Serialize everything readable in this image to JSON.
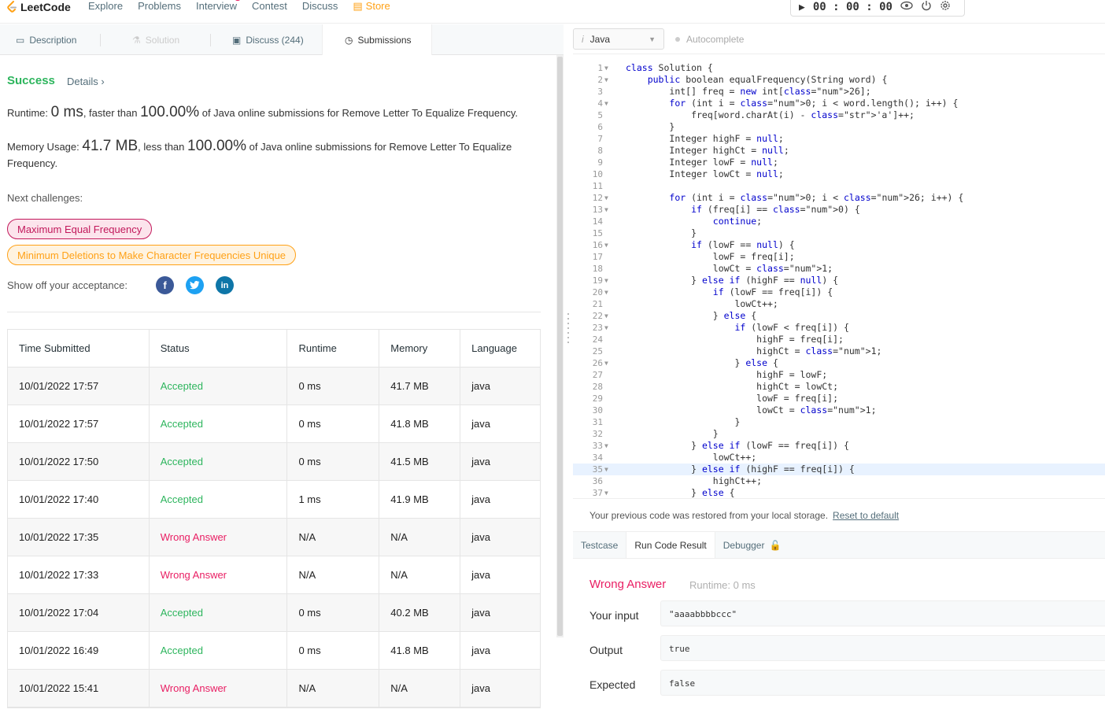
{
  "nav": {
    "logo": "LeetCode",
    "items": [
      "Explore",
      "Problems",
      "Interview",
      "Contest",
      "Discuss"
    ],
    "new_badge": "New",
    "store": "Store",
    "timer": "00 : 00 : 00"
  },
  "tabs": [
    {
      "label": "Description",
      "icon": "description-icon"
    },
    {
      "label": "Solution",
      "icon": "flask-icon"
    },
    {
      "label": "Discuss (244)",
      "icon": "discuss-icon"
    },
    {
      "label": "Submissions",
      "icon": "clock-icon"
    }
  ],
  "result": {
    "status": "Success",
    "details": "Details",
    "runtime_prefix": "Runtime: ",
    "runtime_value": "0 ms",
    "runtime_mid": ", faster than ",
    "runtime_pct": "100.00%",
    "runtime_suffix": " of Java online submissions for Remove Letter To Equalize Frequency.",
    "memory_prefix": "Memory Usage: ",
    "memory_value": "41.7 MB",
    "memory_mid": ", less than ",
    "memory_pct": "100.00%",
    "memory_suffix": " of Java online submissions for Remove Letter To Equalize Frequency.",
    "next_label": "Next challenges:",
    "challenges": [
      "Maximum Equal Frequency",
      "Minimum Deletions to Make Character Frequencies Unique"
    ],
    "show_off": "Show off your acceptance:"
  },
  "table": {
    "headers": [
      "Time Submitted",
      "Status",
      "Runtime",
      "Memory",
      "Language"
    ],
    "rows": [
      [
        "10/01/2022 17:57",
        "Accepted",
        "0 ms",
        "41.7 MB",
        "java"
      ],
      [
        "10/01/2022 17:57",
        "Accepted",
        "0 ms",
        "41.8 MB",
        "java"
      ],
      [
        "10/01/2022 17:50",
        "Accepted",
        "0 ms",
        "41.5 MB",
        "java"
      ],
      [
        "10/01/2022 17:40",
        "Accepted",
        "1 ms",
        "41.9 MB",
        "java"
      ],
      [
        "10/01/2022 17:35",
        "Wrong Answer",
        "N/A",
        "N/A",
        "java"
      ],
      [
        "10/01/2022 17:33",
        "Wrong Answer",
        "N/A",
        "N/A",
        "java"
      ],
      [
        "10/01/2022 17:04",
        "Accepted",
        "0 ms",
        "40.2 MB",
        "java"
      ],
      [
        "10/01/2022 16:49",
        "Accepted",
        "0 ms",
        "41.8 MB",
        "java"
      ],
      [
        "10/01/2022 15:41",
        "Wrong Answer",
        "N/A",
        "N/A",
        "java"
      ]
    ]
  },
  "editor": {
    "language": "Java",
    "autocomplete": "Autocomplete",
    "lines": [
      "class Solution {",
      "    public boolean equalFrequency(String word) {",
      "        int[] freq = new int[26];",
      "        for (int i = 0; i < word.length(); i++) {",
      "            freq[word.charAt(i) - 'a']++;",
      "        }",
      "        Integer highF = null;",
      "        Integer highCt = null;",
      "        Integer lowF = null;",
      "        Integer lowCt = null;",
      "",
      "        for (int i = 0; i < 26; i++) {",
      "            if (freq[i] == 0) {",
      "                continue;",
      "            }",
      "            if (lowF == null) {",
      "                lowF = freq[i];",
      "                lowCt = 1;",
      "            } else if (highF == null) {",
      "                if (lowF == freq[i]) {",
      "                    lowCt++;",
      "                } else {",
      "                    if (lowF < freq[i]) {",
      "                        highF = freq[i];",
      "                        highCt = 1;",
      "                    } else {",
      "                        highF = lowF;",
      "                        highCt = lowCt;",
      "                        lowF = freq[i];",
      "                        lowCt = 1;",
      "                    }",
      "                }",
      "            } else if (lowF == freq[i]) {",
      "                lowCt++;",
      "            } else if (highF == freq[i]) {",
      "                highCt++;",
      "            } else {"
    ],
    "fold_lines": [
      1,
      2,
      4,
      12,
      13,
      16,
      19,
      20,
      22,
      23,
      26,
      33,
      35,
      37
    ],
    "restore_msg": "Your previous code was restored from your local storage.",
    "reset_link": "Reset to default"
  },
  "console": {
    "tabs": [
      "Testcase",
      "Run Code Result",
      "Debugger"
    ],
    "title": "Wrong Answer",
    "runtime": "Runtime: 0 ms",
    "input_label": "Your input",
    "input_value": "\"aaaabbbbccc\"",
    "output_label": "Output",
    "output_value": "true",
    "expected_label": "Expected",
    "expected_value": "false"
  },
  "colors": {
    "accent": "#ffa116",
    "success": "#2db55d",
    "error": "#e91e63"
  }
}
